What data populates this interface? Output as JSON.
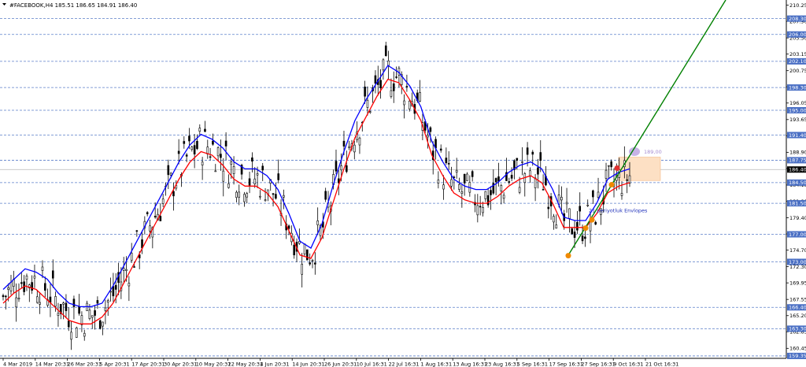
{
  "header": {
    "symbol_line": "#FACEBOOK,H4  185.51 186.65 184.91 186.40"
  },
  "colors": {
    "background": "#ffffff",
    "grid": "#5b7fc9",
    "candle": "#000000",
    "envelope_upper": "#0000ff",
    "envelope_lower": "#ff0000",
    "trendline": "#008000",
    "level_label_bg": "#4a6fc4",
    "current_price_bg": "#000000",
    "target_box": "#fde0c4",
    "target_circle": "#c7b3e6",
    "touch_marker": "#f08a00",
    "annotation_text": "#2233bb"
  },
  "chart_data": {
    "type": "candlestick",
    "title": "#FACEBOOK,H4",
    "ohlc_readout": {
      "open": 185.51,
      "high": 186.65,
      "low": 184.91,
      "close": 186.4
    },
    "ylim": [
      159.0,
      211.0
    ],
    "y_ticks": [
      "210.25",
      "207.90",
      "205.50",
      "203.15",
      "200.75",
      "198.40",
      "196.05",
      "193.65",
      "191.30",
      "188.90",
      "186.55",
      "184.15",
      "181.80",
      "179.40",
      "177.05",
      "174.70",
      "172.30",
      "169.95",
      "167.55",
      "165.20",
      "162.85",
      "160.45"
    ],
    "x_tick_labels": [
      "4 Mar 2019",
      "14 Mar 20:31",
      "26 Mar 20:31",
      "5 Apr 20:31",
      "17 Apr 20:31",
      "30 Apr 20:31",
      "10 May 20:31",
      "22 May 20:31",
      "4 Jun 20:31",
      "14 Jun 20:31",
      "26 Jun 20:31",
      "10 Jul 16:31",
      "22 Jul 16:31",
      "1 Aug 16:31",
      "13 Aug 16:31",
      "23 Aug 16:31",
      "5 Sep 16:31",
      "17 Sep 16:31",
      "27 Sep 16:31",
      "9 Oct 16:31",
      "21 Oct 16:31"
    ],
    "levels": [
      "208.30",
      "206.00",
      "202.10",
      "198.30",
      "195.00",
      "191.40",
      "187.75",
      "184.50",
      "181.50",
      "177.00",
      "173.00",
      "166.40",
      "163.30",
      "159.35"
    ],
    "current_price": "186.40",
    "target_label": "189,00",
    "envelope_label": "21 periyotluk Envlopes",
    "series": [
      {
        "name": "21 periyotluk Envlopes",
        "values": [
          169.0,
          170.5,
          172.0,
          171.5,
          170.5,
          168.5,
          167.0,
          166.5,
          166.5,
          167.0,
          169.5,
          172.5,
          175.5,
          178.5,
          181.5,
          184.5,
          187.5,
          190.0,
          191.5,
          190.8,
          189.5,
          187.5,
          186.5,
          186.5,
          185.5,
          183.5,
          180.0,
          176.0,
          175.0,
          178.5,
          184.0,
          189.0,
          193.5,
          196.5,
          199.0,
          201.5,
          200.5,
          198.5,
          195.5,
          190.5,
          187.5,
          185.0,
          184.0,
          183.5,
          183.5,
          184.5,
          186.0,
          187.0,
          187.5,
          186.5,
          183.5,
          179.5,
          179.0,
          179.0,
          181.5,
          185.0,
          186.0,
          186.5
        ]
      },
      {
        "name": "",
        "values": [
          167.0,
          168.5,
          169.5,
          169.0,
          167.5,
          166.0,
          164.5,
          164.0,
          164.0,
          165.0,
          167.0,
          170.0,
          173.0,
          176.0,
          179.0,
          182.0,
          185.0,
          187.5,
          189.0,
          188.5,
          187.0,
          185.0,
          184.0,
          184.0,
          183.0,
          181.0,
          177.5,
          174.0,
          173.5,
          176.5,
          181.5,
          186.5,
          191.0,
          194.0,
          197.0,
          199.5,
          199.0,
          196.5,
          193.5,
          188.5,
          185.5,
          183.0,
          182.0,
          181.5,
          181.5,
          182.5,
          184.0,
          185.0,
          185.5,
          184.5,
          181.5,
          178.0,
          178.0,
          178.0,
          180.0,
          183.0,
          184.0,
          184.5
        ]
      }
    ],
    "trendline": {
      "from": [
        "27 Sep 16:31",
        173.6
      ],
      "slope_note": ""
    }
  }
}
